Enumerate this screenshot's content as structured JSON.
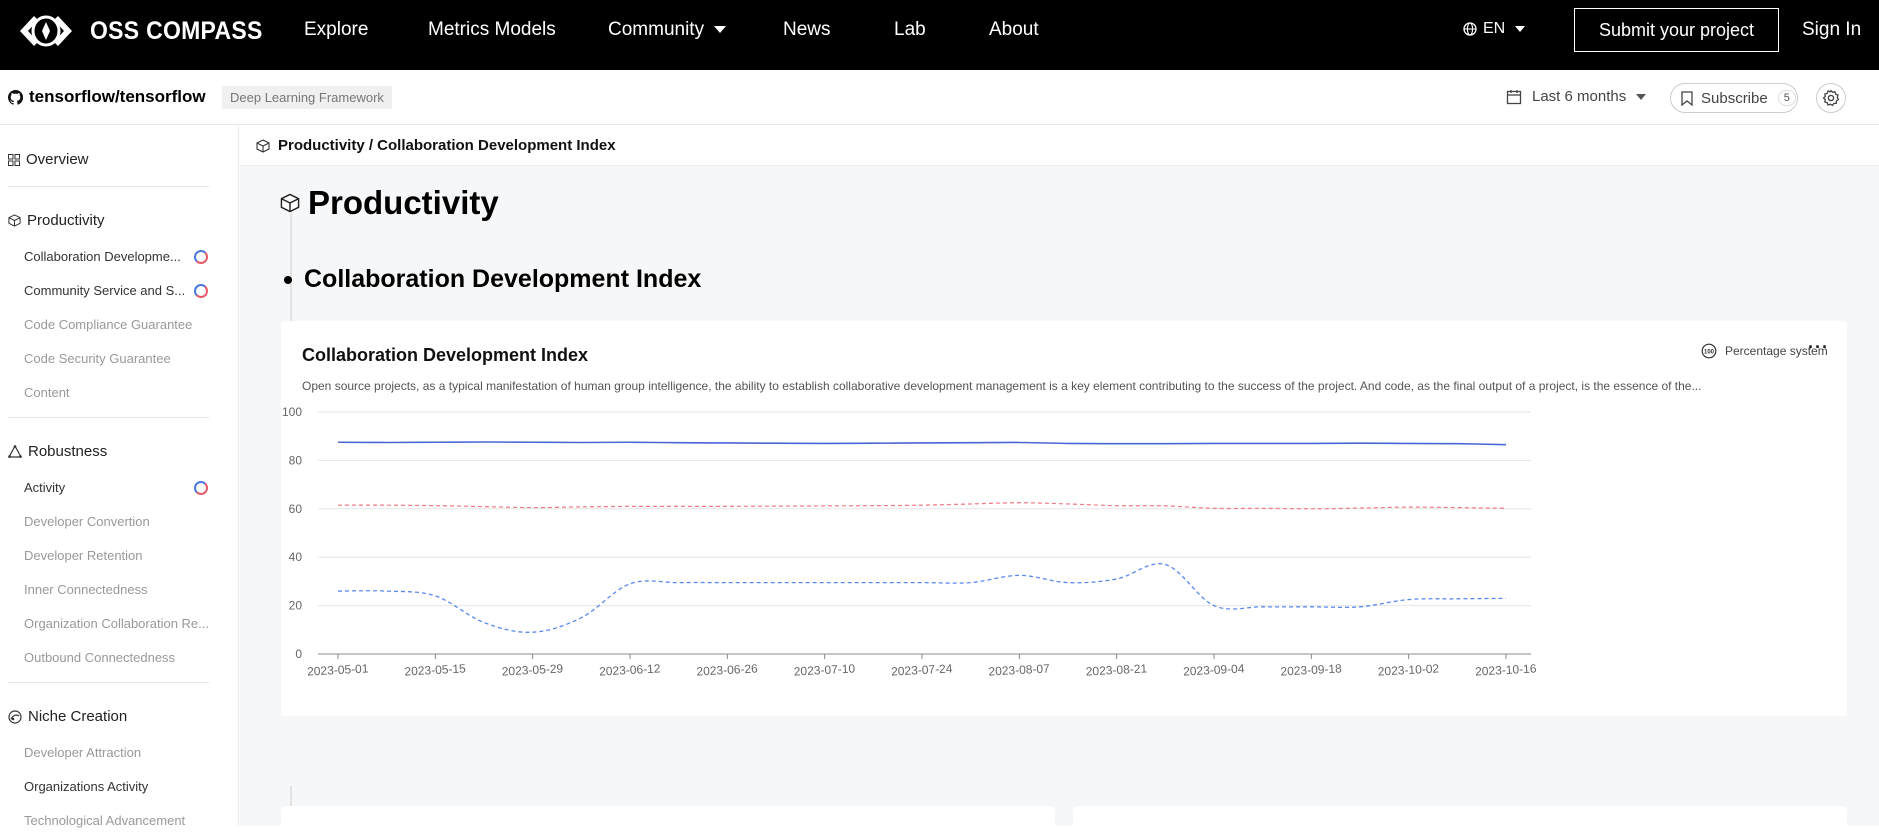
{
  "nav": {
    "logo_text": "OSS COMPASS",
    "items": [
      "Explore",
      "Metrics Models",
      "Community",
      "News",
      "Lab",
      "About"
    ],
    "lang": "EN",
    "submit_label": "Submit your project",
    "signin_label": "Sign In"
  },
  "subheader": {
    "repo": "tensorflow/tensorflow",
    "tag": "Deep Learning Framework",
    "period": "Last 6 months",
    "subscribe_label": "Subscribe",
    "subscribe_count": "5"
  },
  "sidebar": {
    "overview": "Overview",
    "groups": [
      {
        "label": "Productivity",
        "icon": "cube-icon",
        "items": [
          {
            "label": "Collaboration Developme...",
            "active": true,
            "loading": true
          },
          {
            "label": "Community Service and S...",
            "active": true,
            "loading": true
          },
          {
            "label": "Code Compliance Guarantee",
            "active": false
          },
          {
            "label": "Code Security Guarantee",
            "active": false
          },
          {
            "label": "Content",
            "active": false
          }
        ]
      },
      {
        "label": "Robustness",
        "icon": "network-icon",
        "items": [
          {
            "label": "Activity",
            "active": true,
            "loading": true
          },
          {
            "label": "Developer Convertion",
            "active": false
          },
          {
            "label": "Developer Retention",
            "active": false
          },
          {
            "label": "Inner Connectedness",
            "active": false
          },
          {
            "label": "Organization Collaboration Re...",
            "active": false
          },
          {
            "label": "Outbound Connectedness",
            "active": false
          }
        ]
      },
      {
        "label": "Niche Creation",
        "icon": "niche-icon",
        "items": [
          {
            "label": "Developer Attraction",
            "active": false
          },
          {
            "label": "Organizations Activity",
            "active": true
          },
          {
            "label": "Technological Advancement",
            "active": false
          }
        ]
      }
    ]
  },
  "main": {
    "breadcrumb": "Productivity / Collaboration Development Index",
    "section_title": "Productivity",
    "subsection_title": "Collaboration Development Index",
    "card": {
      "title": "Collaboration Development Index",
      "description": "Open source projects, as a typical manifestation of human group intelligence, the ability to establish collaborative development management is a key element contributing to the success of the project. And code, as the final output of a project, is the essence of the...",
      "percentage_label": "Percentage system",
      "more_label": "···"
    }
  },
  "colors": {
    "series_solid": "#4a67d6",
    "series_red": "#f07a84",
    "series_blue_dashed": "#5a8af0",
    "grid": "#e6e6e6"
  },
  "chart_data": {
    "type": "line",
    "x": [
      "2023-05-01",
      "2023-05-08",
      "2023-05-15",
      "2023-05-22",
      "2023-05-29",
      "2023-06-05",
      "2023-06-12",
      "2023-06-19",
      "2023-06-26",
      "2023-07-03",
      "2023-07-10",
      "2023-07-17",
      "2023-07-24",
      "2023-07-31",
      "2023-08-07",
      "2023-08-14",
      "2023-08-21",
      "2023-08-28",
      "2023-09-04",
      "2023-09-11",
      "2023-09-18",
      "2023-09-25",
      "2023-10-02",
      "2023-10-09",
      "2023-10-16"
    ],
    "x_tick_labels": [
      "2023-05-01",
      "2023-05-15",
      "2023-05-29",
      "2023-06-12",
      "2023-06-26",
      "2023-07-10",
      "2023-07-24",
      "2023-08-07",
      "2023-08-21",
      "2023-09-04",
      "2023-09-18",
      "2023-10-02",
      "2023-10-16"
    ],
    "ylim": [
      0,
      100
    ],
    "y_ticks": [
      0,
      20,
      40,
      60,
      80,
      100
    ],
    "series": [
      {
        "style": "solid",
        "values": [
          87.5,
          87.4,
          87.5,
          87.6,
          87.5,
          87.4,
          87.5,
          87.3,
          87.2,
          87.1,
          87.0,
          87.1,
          87.2,
          87.3,
          87.4,
          87.0,
          86.9,
          86.9,
          87.0,
          87.0,
          87.0,
          87.1,
          87.0,
          86.9,
          86.5
        ]
      },
      {
        "style": "dashed-red",
        "values": [
          61.5,
          61.5,
          61.3,
          60.9,
          60.5,
          60.8,
          61.0,
          61.0,
          61.0,
          61.1,
          61.2,
          61.3,
          61.5,
          62.0,
          62.5,
          62.0,
          61.3,
          61.2,
          60.2,
          60.2,
          60.0,
          60.3,
          60.7,
          60.5,
          60.2
        ]
      },
      {
        "style": "dashed-blue",
        "values": [
          26,
          26,
          24,
          13,
          9,
          15,
          29,
          29.5,
          29.5,
          29.5,
          29.5,
          29.5,
          29.5,
          29.5,
          32.5,
          29.5,
          31,
          37,
          20,
          19.5,
          19.5,
          19.5,
          22.5,
          22.8,
          23
        ]
      }
    ],
    "grid": true
  }
}
